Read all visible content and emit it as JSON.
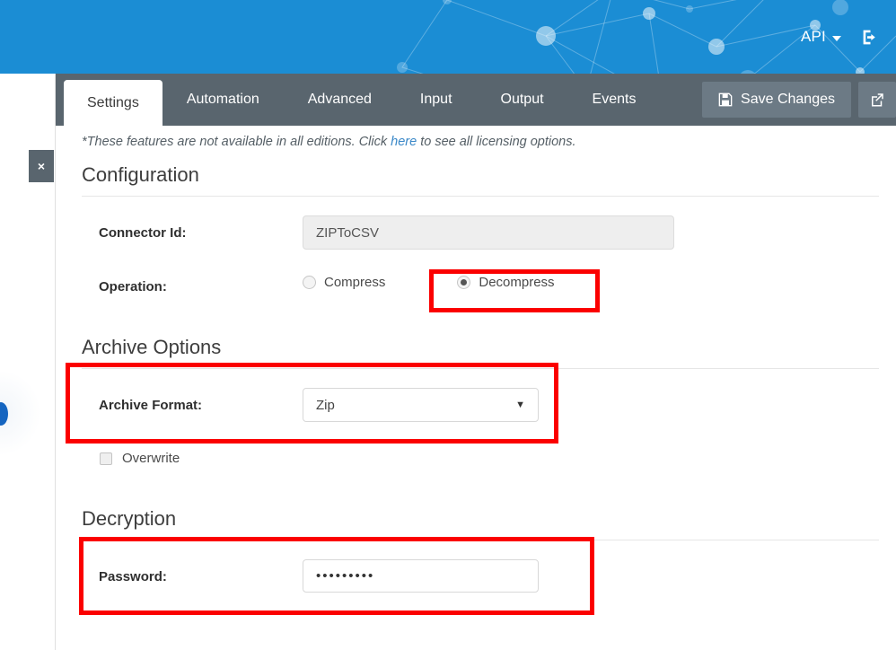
{
  "header": {
    "api_menu_label": "API",
    "api_caret_icon": "chevron-down-icon",
    "logout_icon": "sign-out-icon",
    "background_color": "#1b8dd4",
    "graphic": "network-nodes-graphic"
  },
  "tabbar": {
    "background_color": "#59656e",
    "tabs": [
      {
        "label": "Settings",
        "active": true
      },
      {
        "label": "Automation",
        "active": false
      },
      {
        "label": "Advanced",
        "active": false
      },
      {
        "label": "Input",
        "active": false
      },
      {
        "label": "Output",
        "active": false
      },
      {
        "label": "Events",
        "active": false
      }
    ],
    "save_label": "Save Changes",
    "save_icon": "floppy-disk-icon",
    "external_icon": "external-link-icon"
  },
  "side": {
    "close_label": "×"
  },
  "notice": {
    "prefix": "*These features are not available in all editions. Click ",
    "link": "here",
    "suffix": " to see all licensing options.",
    "link_color": "#3a88c8"
  },
  "sections": {
    "configuration": {
      "title": "Configuration",
      "connector_id_label": "Connector Id:",
      "connector_id_value": "ZIPToCSV",
      "operation_label": "Operation:",
      "operation_options": [
        {
          "label": "Compress",
          "selected": false
        },
        {
          "label": "Decompress",
          "selected": true
        }
      ]
    },
    "archive_options": {
      "title": "Archive Options",
      "archive_format_label": "Archive Format:",
      "archive_format_value": "Zip",
      "archive_format_caret": "▼",
      "overwrite_label": "Overwrite",
      "overwrite_checked": false
    },
    "decryption": {
      "title": "Decryption",
      "password_label": "Password:",
      "password_value": "•••••••••"
    }
  },
  "highlights": {
    "color": "#fb0000",
    "boxes": [
      "decompress-option",
      "archive-format-row",
      "password-row"
    ]
  }
}
